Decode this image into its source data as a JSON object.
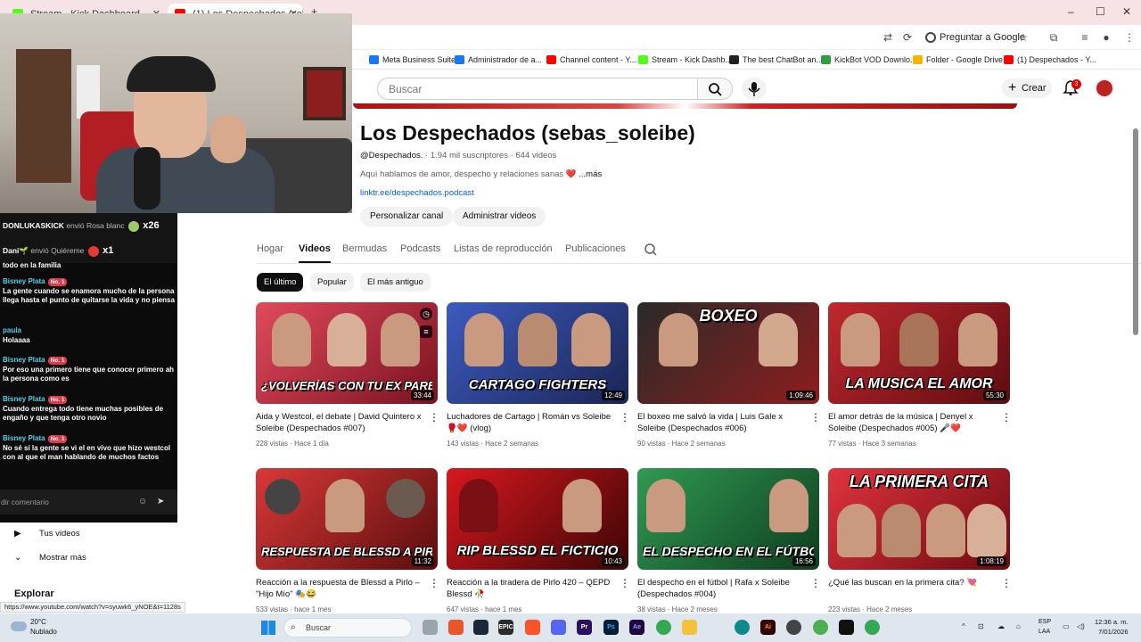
{
  "browser": {
    "tabs": [
      {
        "label": "Stream - Kick Dashboard",
        "favicon_color": "#53fc18"
      },
      {
        "label": "(1) Los Despechados (sebas",
        "favicon_color": "#ff0000"
      }
    ],
    "new_tab": "+",
    "window_controls": {
      "minimize": "–",
      "maximize": "☐",
      "close": "✕"
    },
    "google_button": "Preguntar a Google",
    "bookmarks": [
      {
        "label": "Meta Business Suite",
        "color": "#1877f2"
      },
      {
        "label": "Administrador de a...",
        "color": "#1877f2"
      },
      {
        "label": "Channel content - Y...",
        "color": "#ff0000"
      },
      {
        "label": "Stream - Kick Dashb...",
        "color": "#53fc18"
      },
      {
        "label": "The best ChatBot an...",
        "color": "#222222"
      },
      {
        "label": "KickBot VOD Downlo...",
        "color": "#2e9e3e"
      },
      {
        "label": "Folder - Google Drive",
        "color": "#f4b400"
      },
      {
        "label": "(1) Despechados - Y...",
        "color": "#ff0000"
      }
    ]
  },
  "youtube": {
    "search_placeholder": "Buscar",
    "create_label": "Crear",
    "notifications": "3"
  },
  "channel": {
    "name": "Los Despechados (sebas_soleibe)",
    "handle": "@Despechados.",
    "subscribers": "· 1.94 mil suscriptores",
    "video_count": "· 644 videos",
    "description": "Aquí hablamos de amor, despecho y relaciones sanas ❤️",
    "more": "...más",
    "link": "linktr.ee/despechados.podcast",
    "customize_button": "Personalizar canal",
    "manage_button": "Administrar videos",
    "tabs": [
      "Hogar",
      "Videos",
      "Bermudas",
      "Podcasts",
      "Listas de reproducción",
      "Publicaciones"
    ],
    "active_tab": "Videos",
    "chips": [
      "El último",
      "Popular",
      "El más antiguo"
    ]
  },
  "videos": [
    {
      "title": "Aida y Westcol, el debate | David Quintero x Soleibe (Despechados #007)",
      "meta": "228 vistas · Hace 1 día",
      "duration": "33:44",
      "thumb_text": "¿VOLVERÍAS CON TU EX PAREJA?",
      "bg": "#c7263a"
    },
    {
      "title": "Luchadores de Cartago | Román vs Soleibe 🥊❤️ (vlog)",
      "meta": "143 vistas · Hace 2 semanas",
      "duration": "12:49",
      "thumb_text": "CARTAGO FIGHTERS",
      "bg": "#2a3f8c"
    },
    {
      "title": "El boxeo me salvó la vida | Luis Gale x Soleibe (Despechados #006)",
      "meta": "90 vistas · Hace 2 semanas",
      "duration": "1:09:46",
      "thumb_text": "BOXEO",
      "bg": "#8e1d1d"
    },
    {
      "title": "El amor detrás de la música | Denyel x Soleibe (Despechados #005) 🎤❤️",
      "meta": "77 vistas · Hace 3 semanas",
      "duration": "55:30",
      "thumb_text": "LA MÚSICA EL AMOR",
      "bg": "#a51c24"
    },
    {
      "title": "Reacción a la respuesta de Blessd a Pirlo – \"Hijo Mío\" 🎭😂",
      "meta": "533 vistas · hace 1 mes",
      "duration": "11:32",
      "thumb_text": "RESPUESTA DE BLESSD A PIRLO",
      "bg": "#b8201f"
    },
    {
      "title": "Reacción a la tiradera de Pirlo 420 – QEPD Blessd 🥀",
      "meta": "647 vistas · hace 1 mes",
      "duration": "10:43",
      "thumb_text": "RIP BLESSD EL FICTICIO",
      "bg": "#9b1116"
    },
    {
      "title": "El despecho en el fútbol | Rafa x Soleibe (Despechados #004)",
      "meta": "38 vistas · Hace 2 meses",
      "duration": "16:56",
      "thumb_text": "EL DESPECHO EN EL FÚTBOL",
      "bg": "#1f7a3a"
    },
    {
      "title": "¿Qué las buscan en la primera cita? 💘",
      "meta": "223 vistas · Hace 2 meses",
      "duration": "1:08:19",
      "thumb_text": "LA PRIMERA CITA",
      "bg": "#b3141e"
    }
  ],
  "chat": {
    "gifts": [
      {
        "user": "DONLUKASKICK",
        "action": "envió Rosa blanc",
        "count": "x26",
        "color": "#9ccc65"
      },
      {
        "user": "Dani🌱",
        "action": "envió Quiéreme",
        "count": "x1",
        "color": "#e53935"
      }
    ],
    "messages": [
      {
        "user": "",
        "rank": "",
        "text": "todo en la familia"
      },
      {
        "user": "Bisney Plata",
        "rank": "No. 1",
        "text": "La gente cuando se enamora mucho de la persona llega hasta el punto de quitarse la vida y no piensa"
      },
      {
        "user": "paula",
        "rank": "",
        "text": "Holaaaa"
      },
      {
        "user": "Bisney Plata",
        "rank": "No. 1",
        "text": "Por eso una primero tiene que conocer primero ah la persona como es"
      },
      {
        "user": "Bisney Plata",
        "rank": "No. 1",
        "text": "Cuando entrega todo tiene muchas posibles de engaño y que tenga otro novio"
      },
      {
        "user": "Bisney Plata",
        "rank": "No. 1",
        "text": "No sé si la gente se vi el en vivo que hizo westcol con al que el man hablando de muchos factos"
      }
    ],
    "input_placeholder": "dir comentario"
  },
  "sidebar": {
    "tus_videos": "Tus videos",
    "mostrar_mas": "Mostrar más",
    "explorar": "Explorar"
  },
  "status_url": "https://www.youtube.com/watch?v=syuwk6_yNOE&t=1128s",
  "taskbar": {
    "weather_temp": "20°C",
    "weather_desc": "Nublado",
    "search": "Buscar",
    "lang_top": "ESP",
    "lang_bottom": "LAA",
    "time": "12:36 a. m.",
    "date": "7/01/2026"
  }
}
